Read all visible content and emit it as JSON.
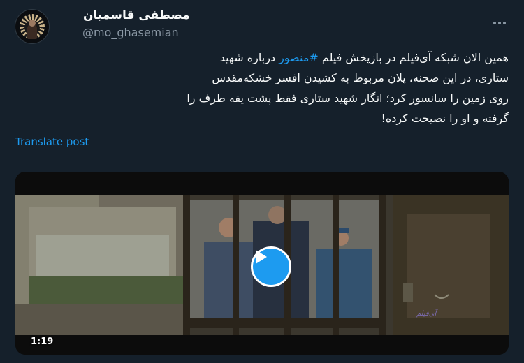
{
  "author": {
    "display_name": "مصطفی قاسمیان",
    "handle": "@mo_ghasemian"
  },
  "tweet": {
    "lines": [
      {
        "before": "همین الان شبکه آی‌فیلم در بازپخش فیلم ",
        "hashtag": "#منصور",
        "after": " درباره شهید"
      },
      {
        "text": "ستاری، در این صحنه، پلان مربوط به کشیدن افسر خشکه‌مقدس"
      },
      {
        "text": "روی زمین را سانسور کرد؛ انگار شهید ستاری فقط پشت یقه طرف را"
      },
      {
        "text": "گرفته و او را نصیحت کرده!"
      }
    ],
    "translate_label": "Translate post"
  },
  "media": {
    "duration": "1:19",
    "watermark": "آی‌فیلم"
  },
  "icons": {
    "more": "more-options-icon",
    "play": "play-icon"
  },
  "colors": {
    "background": "#15202b",
    "accent": "#1d9bf0",
    "secondary_text": "#8b98a5"
  }
}
